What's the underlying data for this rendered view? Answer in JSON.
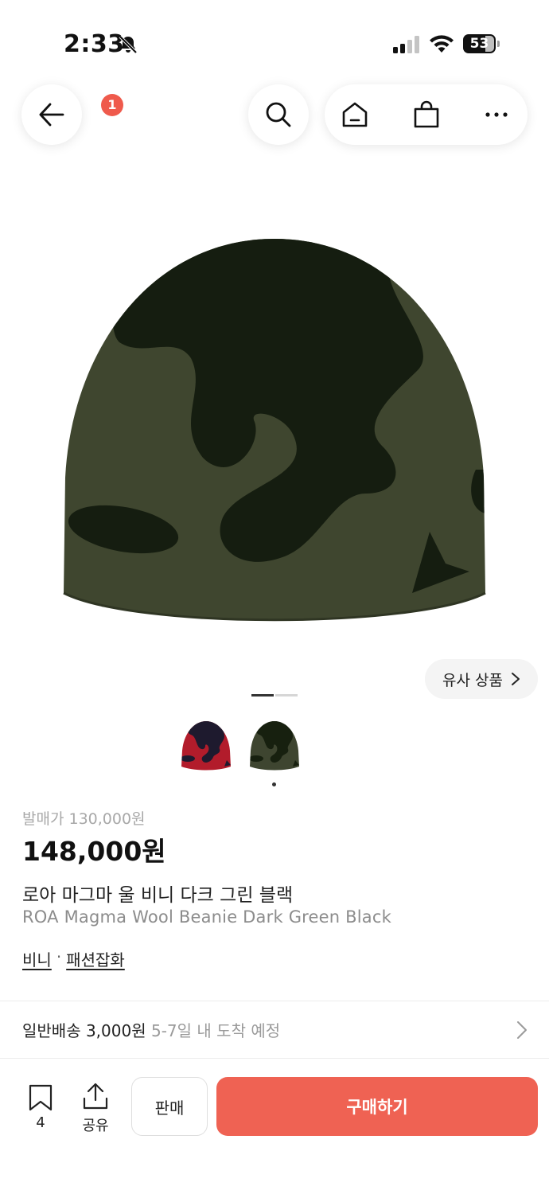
{
  "status_bar": {
    "time": "2:33",
    "battery": "53",
    "bell_icon": "bell-slash-icon",
    "signal_icon": "cellular-signal-icon",
    "wifi_icon": "wifi-icon"
  },
  "nav": {
    "back_icon": "arrow-left-icon",
    "search_icon": "search-icon",
    "home_icon": "home-icon",
    "cart_icon": "shopping-bag-icon",
    "cart_badge": "1",
    "more_icon": "more-horizontal-icon"
  },
  "gallery": {
    "similar_label": "유사 상품",
    "similar_chevron": ">",
    "indicator_count": 2,
    "active_indicator": 1,
    "thumbnails": [
      {
        "color_name": "red-black",
        "primary": "#b21c2b",
        "secondary": "#1e1a2e"
      },
      {
        "color_name": "dark-green-black",
        "primary": "#3e4530",
        "secondary": "#17200f"
      }
    ],
    "selected_thumbnail": 2
  },
  "product": {
    "release_price": "발매가 130,000원",
    "price": "148,000원",
    "name_ko": "로아 마그마 울 비니 다크 그린 블랙",
    "name_en": "ROA Magma Wool Beanie Dark Green Black",
    "category_1": "비니",
    "category_separator": "·",
    "category_2": "패션잡화"
  },
  "shipping": {
    "label": "일반배송 3,000원",
    "eta": "5-7일 내 도착 예정"
  },
  "bottom_bar": {
    "bookmark_count": "4",
    "share_label": "공유",
    "sell_label": "판매",
    "buy_label": "구매하기"
  },
  "colors": {
    "accent": "#ef6253",
    "badge": "#ef5a4c",
    "beanie_green": "#3f462f",
    "beanie_black": "#151d10"
  }
}
